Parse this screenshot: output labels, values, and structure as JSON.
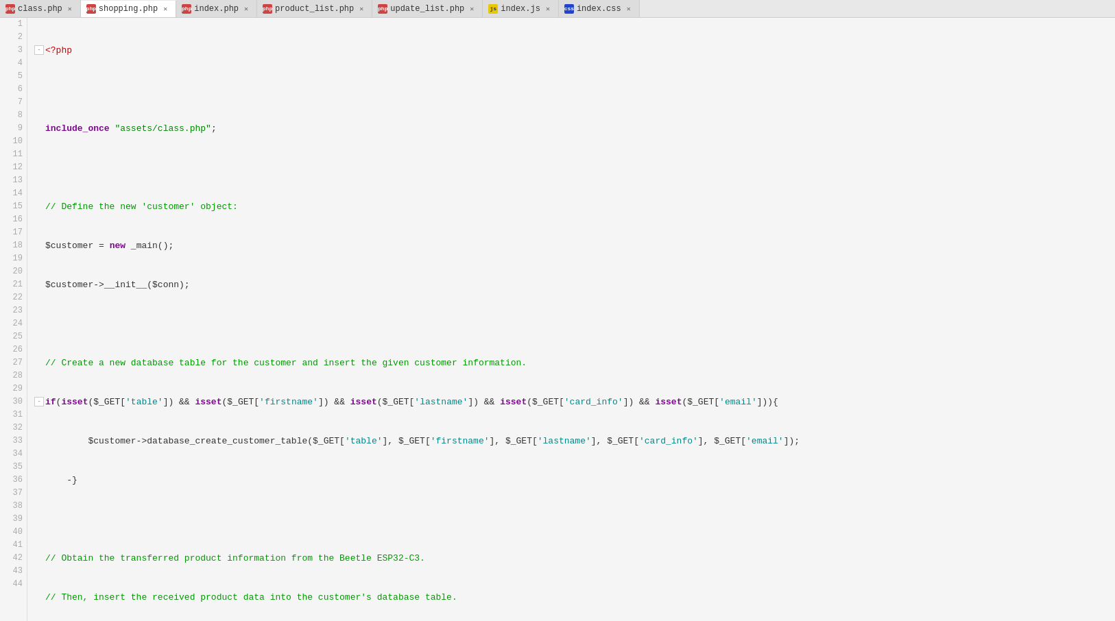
{
  "tabs": [
    {
      "id": "class-php",
      "label": "class.php",
      "type": "php",
      "active": false,
      "modified": false
    },
    {
      "id": "shopping-php",
      "label": "shopping.php",
      "type": "php",
      "active": true,
      "modified": false
    },
    {
      "id": "index-php",
      "label": "index.php",
      "type": "php",
      "active": false,
      "modified": false
    },
    {
      "id": "product-list-php",
      "label": "product_list.php",
      "type": "php",
      "active": false,
      "modified": false
    },
    {
      "id": "update-list-php",
      "label": "update_list.php",
      "type": "php",
      "active": false,
      "modified": false
    },
    {
      "id": "index-js",
      "label": "index.js",
      "type": "js",
      "active": false,
      "modified": false
    },
    {
      "id": "index-css",
      "label": "index.css",
      "type": "css",
      "active": false,
      "modified": false
    }
  ],
  "lines": [
    "1",
    "2",
    "3",
    "4",
    "5",
    "6",
    "7",
    "8",
    "9",
    "10",
    "11",
    "12",
    "13",
    "14",
    "15",
    "16",
    "17",
    "18",
    "19",
    "20",
    "21",
    "22",
    "23",
    "24",
    "25",
    "26",
    "27",
    "28",
    "29",
    "30",
    "31",
    "32",
    "33",
    "34",
    "35",
    "36",
    "37",
    "38",
    "39",
    "40",
    "41",
    "42",
    "43",
    "44"
  ]
}
